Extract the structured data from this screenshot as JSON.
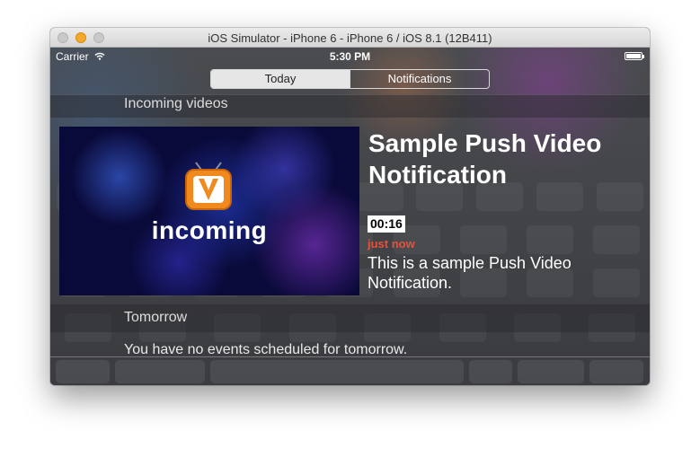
{
  "window": {
    "title": "iOS Simulator - iPhone 6 - iPhone 6 / iOS 8.1 (12B411)"
  },
  "status_bar": {
    "carrier": "Carrier",
    "time": "5:30 PM"
  },
  "segmented_control": {
    "tabs": [
      {
        "label": "Today",
        "selected": true
      },
      {
        "label": "Notifications",
        "selected": false
      }
    ]
  },
  "incoming_videos": {
    "header": "Incoming videos",
    "thumbnail_text": "incoming",
    "title": "Sample Push Video Notification",
    "duration": "00:16",
    "timestamp": "just now",
    "body": "This is a sample Push Video Notification.",
    "timestamp_color": "#e8503a"
  },
  "tomorrow": {
    "header": "Tomorrow",
    "message": "You have no events scheduled for tomorrow."
  },
  "icons": [
    "wifi-icon",
    "battery-icon",
    "tv-logo-icon",
    "grabber-icon"
  ]
}
